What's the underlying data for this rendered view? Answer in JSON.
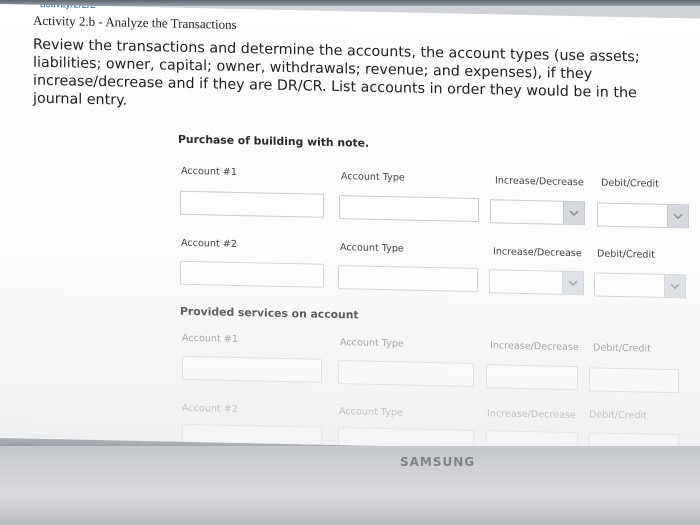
{
  "browser": {
    "url_fragment": "activity/2/2/2"
  },
  "activity": {
    "title": "Activity 2.b - Analyze the Transactions",
    "instructions": "Review the transactions and determine the accounts, the account types (use assets; liabilities; owner, capital; owner, withdrawals; revenue; and expenses), if they increase/decrease and if they are DR/CR. List accounts in order they would be in the journal entry."
  },
  "transactions": [
    {
      "label": "Purchase of building with note.",
      "rows": [
        {
          "account": "Account #1",
          "type": "Account Type",
          "incdec": "Increase/Decrease",
          "drcr": "Debit/Credit"
        },
        {
          "account": "Account #2",
          "type": "Account Type",
          "incdec": "Increase/Decrease",
          "drcr": "Debit/Credit"
        }
      ]
    },
    {
      "label": "Provided services on account",
      "rows": [
        {
          "account": "Account #1",
          "type": "Account Type",
          "incdec": "Increase/Decrease",
          "drcr": "Debit/Credit"
        },
        {
          "account": "Account #2",
          "type": "Account Type",
          "incdec": "Increase/Decrease",
          "drcr": "Debit/Credit"
        }
      ]
    }
  ],
  "device": {
    "brand": "SAMSUNG"
  }
}
